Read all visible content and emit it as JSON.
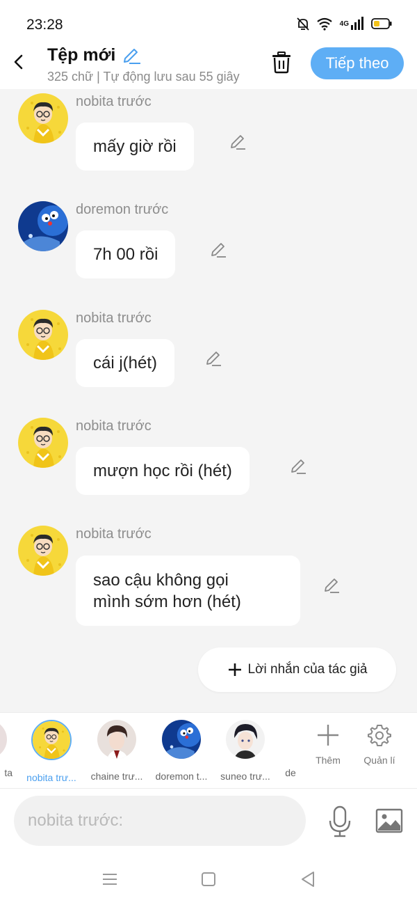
{
  "status_bar": {
    "time": "23:28",
    "network": "4G"
  },
  "header": {
    "title": "Tệp mới",
    "subtitle": "325 chữ | Tự động lưu sau 55 giây",
    "next_label": "Tiếp theo"
  },
  "messages": [
    {
      "sender": "nobita trước",
      "text": "mấy giờ rồi",
      "avatar": "nobita"
    },
    {
      "sender": "doremon trước",
      "text": "7h 00 rồi",
      "avatar": "doremon"
    },
    {
      "sender": "nobita trước",
      "text": "cái j(hét)",
      "avatar": "nobita"
    },
    {
      "sender": "nobita trước",
      "text": "mượn học rồi (hét)",
      "avatar": "nobita"
    },
    {
      "sender": "nobita trước",
      "text_line1": "sao cậu không gọi",
      "text_line2": "mình sớm hơn (hét)",
      "avatar": "nobita"
    }
  ],
  "author_note_label": "Lời nhắn của tác giả",
  "characters": [
    {
      "name": "ta",
      "selected": false
    },
    {
      "name": "nobita trư...",
      "selected": true
    },
    {
      "name": "chaine trư...",
      "selected": false
    },
    {
      "name": "doremon t...",
      "selected": false
    },
    {
      "name": "suneo trư...",
      "selected": false
    },
    {
      "name": "de",
      "selected": false
    }
  ],
  "strip_actions": {
    "add_label": "Thêm",
    "manage_label": "Quản lí"
  },
  "input": {
    "placeholder": "nobita trước:"
  },
  "colors": {
    "accent": "#5eaef5",
    "background": "#f4f4f4",
    "bubble": "#ffffff"
  },
  "icons": [
    "back-arrow-icon",
    "pencil-icon",
    "trash-icon",
    "plus-icon",
    "gear-icon",
    "mic-icon",
    "image-icon",
    "menu-icon",
    "home-icon",
    "back-triangle-icon"
  ]
}
